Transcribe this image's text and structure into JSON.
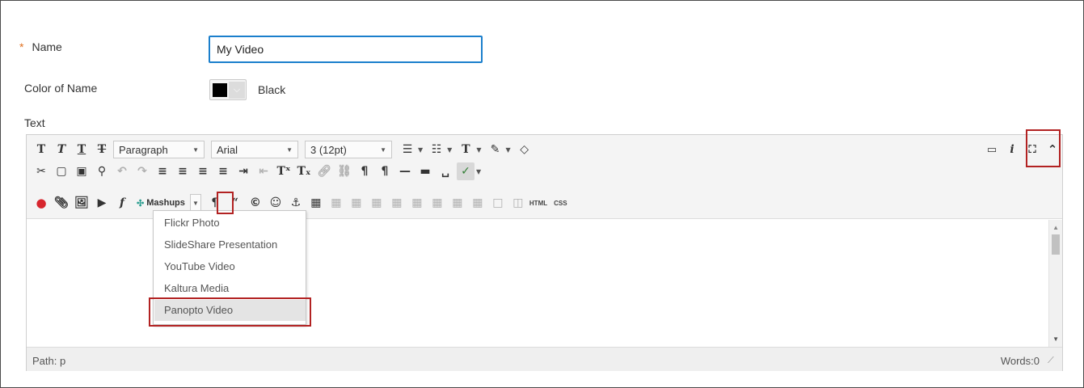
{
  "form": {
    "name_required_mark": "*",
    "name_label": "Name",
    "name_value": "My Video",
    "color_label": "Color of Name",
    "color_value": "Black",
    "text_label": "Text"
  },
  "toolbar": {
    "paragraph": "Paragraph",
    "font": "Arial",
    "size": "3 (12pt)",
    "mashups": "Mashups",
    "html": "HTML",
    "css": "CSS"
  },
  "mashups_menu": {
    "items": [
      "Flickr Photo",
      "SlideShare Presentation",
      "YouTube Video",
      "Kaltura Media",
      "Panopto Video"
    ],
    "active_item": "Panopto Video"
  },
  "status": {
    "path": "Path: p",
    "words": "Words:0"
  },
  "colors": {
    "focus_border": "#1b7fcc",
    "highlight": "#b22222",
    "required": "#e07020"
  }
}
